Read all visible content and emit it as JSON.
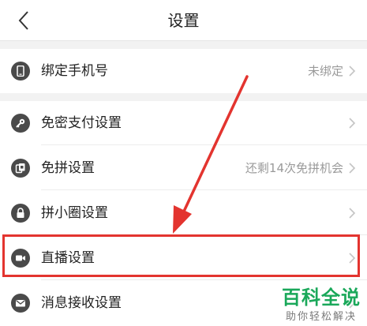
{
  "header": {
    "title": "设置"
  },
  "group1": [
    {
      "id": "bind-phone",
      "icon": "phone-icon",
      "label": "绑定手机号",
      "value": "未绑定"
    }
  ],
  "group2": [
    {
      "id": "password-free-pay",
      "icon": "key-icon",
      "label": "免密支付设置",
      "value": ""
    },
    {
      "id": "free-group",
      "icon": "cards-icon",
      "label": "免拼设置",
      "value": "还剩14次免拼机会"
    },
    {
      "id": "circle",
      "icon": "lock-icon",
      "label": "拼小圈设置",
      "value": ""
    },
    {
      "id": "live",
      "icon": "video-camera-icon",
      "label": "直播设置",
      "value": ""
    },
    {
      "id": "messages",
      "icon": "mail-icon",
      "label": "消息接收设置",
      "value": ""
    }
  ],
  "watermark": {
    "title": "百科全说",
    "subtitle": "助你轻松解决"
  },
  "colors": {
    "highlight": "#e3342f",
    "watermark": "#1aa85a",
    "icon": "#4a4a4a"
  }
}
